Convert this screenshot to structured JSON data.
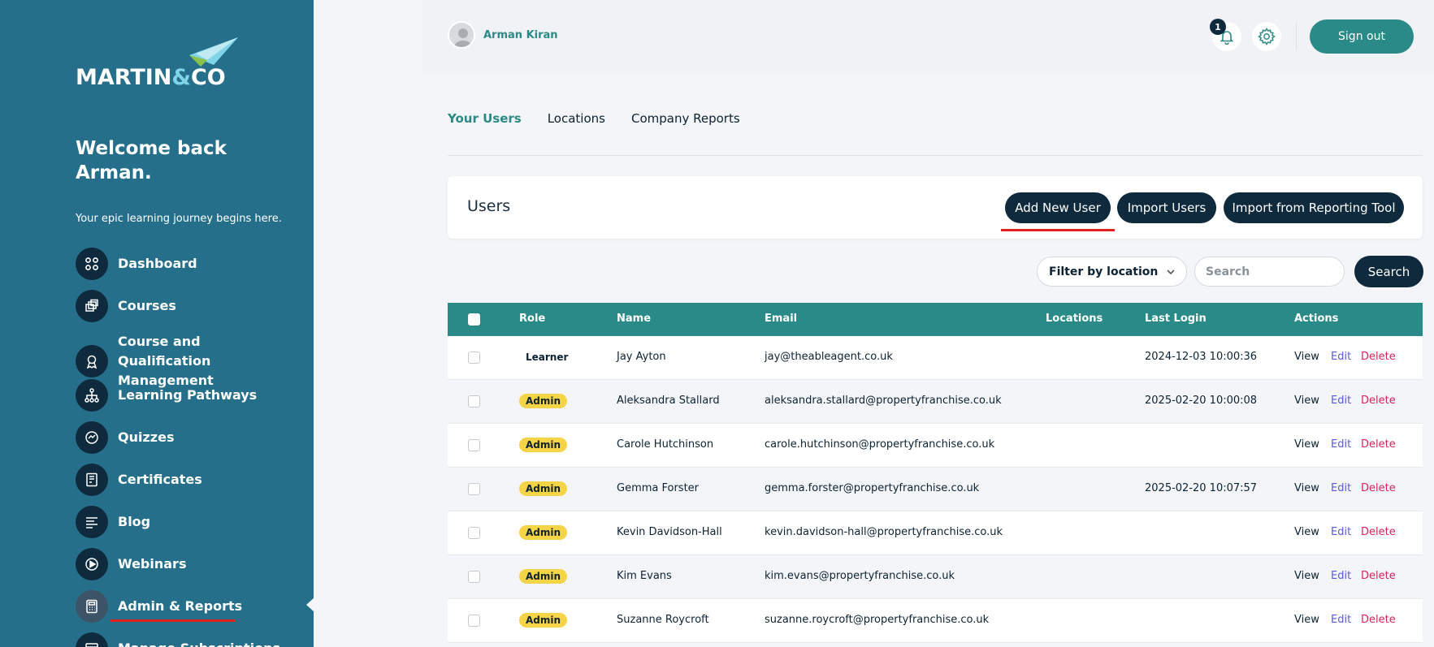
{
  "brand": {
    "logo_text_a": "MARTIN",
    "logo_text_amp": "&",
    "logo_text_b": "CO"
  },
  "sidebar": {
    "welcome": "Welcome back Arman.",
    "tagline": "Your epic learning journey begins here.",
    "items": [
      {
        "label": "Dashboard",
        "icon": "dashboard-icon"
      },
      {
        "label": "Courses",
        "icon": "courses-icon"
      },
      {
        "label": "Course and Qualification Management",
        "icon": "award-icon"
      },
      {
        "label": "Learning Pathways",
        "icon": "pathways-icon"
      },
      {
        "label": "Quizzes",
        "icon": "quiz-icon"
      },
      {
        "label": "Certificates",
        "icon": "certificate-icon"
      },
      {
        "label": "Blog",
        "icon": "blog-icon"
      },
      {
        "label": "Webinars",
        "icon": "play-icon"
      },
      {
        "label": "Admin & Reports",
        "icon": "calculator-icon",
        "active": true
      },
      {
        "label": "Manage Subscriptions",
        "icon": "subscriptions-icon"
      }
    ]
  },
  "header": {
    "user_name": "Arman Kiran",
    "notification_count": "1",
    "signout_label": "Sign out"
  },
  "tabs": [
    {
      "label": "Your Users",
      "active": true
    },
    {
      "label": "Locations"
    },
    {
      "label": "Company Reports"
    }
  ],
  "users_panel": {
    "title": "Users",
    "add_label": "Add New User",
    "import_label": "Import Users",
    "import_reporting_label": "Import from Reporting Tool"
  },
  "filters": {
    "location_label": "Filter by location",
    "search_placeholder": "Search",
    "search_button": "Search"
  },
  "table": {
    "columns": [
      "Role",
      "Name",
      "Email",
      "Locations",
      "Last Login",
      "Actions"
    ],
    "action_labels": {
      "view": "View",
      "edit": "Edit",
      "delete": "Delete"
    },
    "rows": [
      {
        "role": "Learner",
        "name": "Jay Ayton",
        "email": "jay@theableagent.co.uk",
        "locations": "",
        "last_login": "2024-12-03 10:00:36"
      },
      {
        "role": "Admin",
        "name": "Aleksandra Stallard",
        "email": "aleksandra.stallard@propertyfranchise.co.uk",
        "locations": "",
        "last_login": "2025-02-20 10:00:08"
      },
      {
        "role": "Admin",
        "name": "Carole Hutchinson",
        "email": "carole.hutchinson@propertyfranchise.co.uk",
        "locations": "",
        "last_login": ""
      },
      {
        "role": "Admin",
        "name": "Gemma Forster",
        "email": "gemma.forster@propertyfranchise.co.uk",
        "locations": "",
        "last_login": "2025-02-20 10:07:57"
      },
      {
        "role": "Admin",
        "name": "Kevin Davidson-Hall",
        "email": "kevin.davidson-hall@propertyfranchise.co.uk",
        "locations": "",
        "last_login": ""
      },
      {
        "role": "Admin",
        "name": "Kim Evans",
        "email": "kim.evans@propertyfranchise.co.uk",
        "locations": "",
        "last_login": ""
      },
      {
        "role": "Admin",
        "name": "Suzanne Roycroft",
        "email": "suzanne.roycroft@propertyfranchise.co.uk",
        "locations": "",
        "last_login": ""
      }
    ]
  },
  "colors": {
    "sidebar": "#266f8a",
    "accent": "#2a8a87",
    "dark": "#0f2a3d",
    "admin_badge": "#f5d547",
    "delete": "#d6245a",
    "edit": "#5a5bd0",
    "highlight": "#e0201c"
  }
}
